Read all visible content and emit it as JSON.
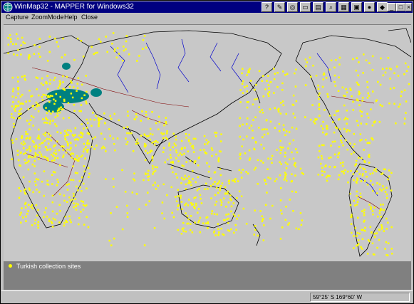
{
  "window": {
    "title": "WinMap32 - MAPPER for Windows32",
    "toolbar_icons": [
      "help-tool-icon",
      "map-tool-icon",
      "globe-tool-icon",
      "display-tool-icon",
      "print-tool-icon",
      "search-tool-icon",
      "grid-tool-icon",
      "photo-tool-icon",
      "record-tool-icon",
      "color-tool-icon",
      "stop-tool-icon"
    ],
    "controls": {
      "minimize": "_",
      "maximize": "□",
      "close": "×"
    }
  },
  "menu": {
    "items": [
      "Capture",
      "ZoomMode",
      "Help",
      "Close"
    ]
  },
  "map": {
    "projection": "world map, Pacific-centered",
    "ocean_color": "#c8c8c8",
    "land_outline_color": "#000000",
    "river_color": "#0000cc",
    "border_color": "#800000",
    "site_color": "#ffff00",
    "highlight_color": "#008080"
  },
  "legend": {
    "label": "Turkish collection sites",
    "marker_color": "#ffff00"
  },
  "status": {
    "coords": "59°25' S  169°60' W"
  }
}
